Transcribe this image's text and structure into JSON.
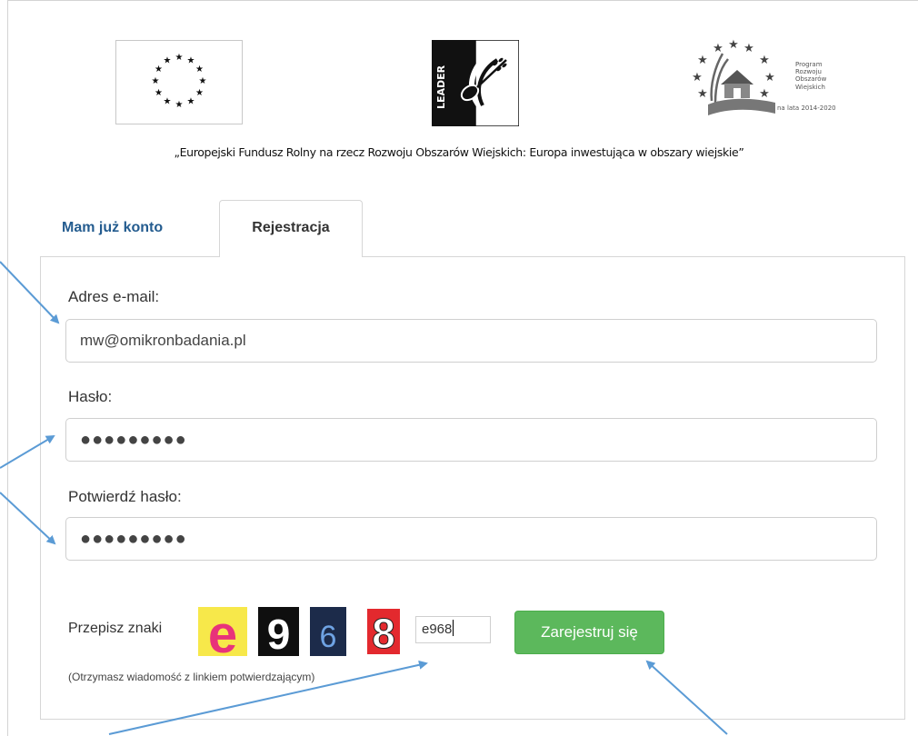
{
  "header": {
    "tagline": "„Europejski Fundusz Rolny na rzecz Rozwoju Obszarów Wiejskich: Europa inwestująca w obszary wiejskie”",
    "logos": {
      "eu": "eu-flag-icon",
      "leader": {
        "icon": "leader-logo-icon",
        "text": "LEADER"
      },
      "prow": {
        "icon": "prow-logo-icon",
        "lines": [
          "Program",
          "Rozwoju",
          "Obszarów",
          "Wiejskich"
        ],
        "sub": "na lata 2014-2020"
      }
    }
  },
  "tabs": {
    "login": "Mam już konto",
    "register": "Rejestracja"
  },
  "form": {
    "email_label": "Adres e-mail:",
    "email_value": "mw@omikronbadania.pl",
    "password_label": "Hasło:",
    "password_value": "●●●●●●●●●",
    "confirm_label": "Potwierdź hasło:",
    "confirm_value": "●●●●●●●●●",
    "captcha_label": "Przepisz znaki",
    "captcha_chars": [
      "e",
      "9",
      "6",
      "8"
    ],
    "captcha_value": "e968",
    "submit_label": "Zarejestruj się",
    "hint": "(Otrzymasz wiadomość z linkiem potwierdzającym)"
  },
  "colors": {
    "link_blue": "#245c8f",
    "button_green": "#5cb85c",
    "arrow_blue": "#5b9bd5"
  }
}
